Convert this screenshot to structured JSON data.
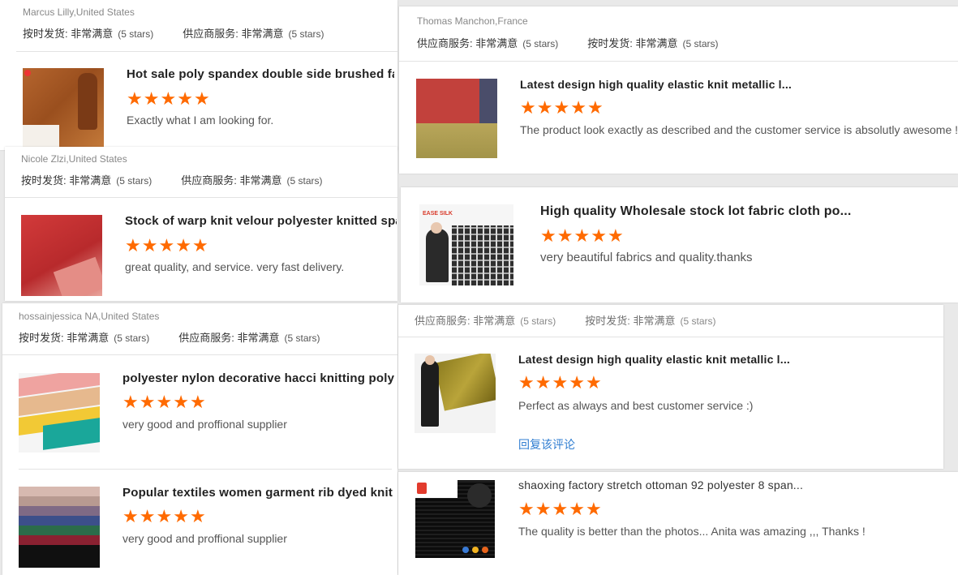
{
  "colors": {
    "star": "#ff6a00",
    "link": "#2f7dd1"
  },
  "icons": {
    "star": "star-icon"
  },
  "cards": [
    {
      "buyer": "Marcus Lilly,United States",
      "meta1_label": "按时发货: 非常满意",
      "meta1_stars": "(5 stars)",
      "meta2_label": "供应商服务: 非常满意",
      "meta2_stars": "(5 stars)",
      "title": "Hot sale poly spandex double side brushed fau",
      "comment": "Exactly what I am looking for."
    },
    {
      "buyer": "Nicole Zlzi,United States",
      "meta1_label": "按时发货: 非常满意",
      "meta1_stars": "(5 stars)",
      "meta2_label": "供应商服务: 非常满意",
      "meta2_stars": "(5 stars)",
      "title": "Stock of warp knit velour polyester knitted spa...",
      "comment": "great quality, and service. very fast delivery."
    },
    {
      "buyer": "hossainjessica NA,United States",
      "meta1_label": "按时发货: 非常满意",
      "meta1_stars": "(5 stars)",
      "meta2_label": "供应商服务: 非常满意",
      "meta2_stars": "(5 stars)",
      "title": "polyester nylon decorative hacci knitting poly a...",
      "comment": "very good and proffional supplier",
      "title2": "Popular textiles women garment rib dyed knit s...",
      "comment2": "very good and proffional supplier"
    },
    {
      "buyer": "Thomas Manchon,France",
      "meta1_label": "供应商服务: 非常满意",
      "meta1_stars": "(5 stars)",
      "meta2_label": "按时发货: 非常满意",
      "meta2_stars": "(5 stars)",
      "title": "Latest design high quality elastic knit metallic l...",
      "comment": "The product look exactly as described and the customer service is absolutly awesome ! T"
    },
    {
      "title": "High quality Wholesale stock lot fabric cloth po...",
      "comment": "very beautiful fabrics and quality.thanks",
      "logo_text": "EASE SILK"
    },
    {
      "meta1_label": "供应商服务: 非常满意",
      "meta1_stars": "(5 stars)",
      "meta2_label": "按时发货: 非常满意",
      "meta2_stars": "(5 stars)",
      "title": "Latest design high quality elastic knit metallic l...",
      "comment": "Perfect as always and best customer service :)",
      "reply": "回复该评论"
    },
    {
      "title": "shaoxing factory stretch ottoman 92 polyester 8 span...",
      "comment": "The quality is better than the photos... Anita was amazing ,,, Thanks !"
    }
  ]
}
